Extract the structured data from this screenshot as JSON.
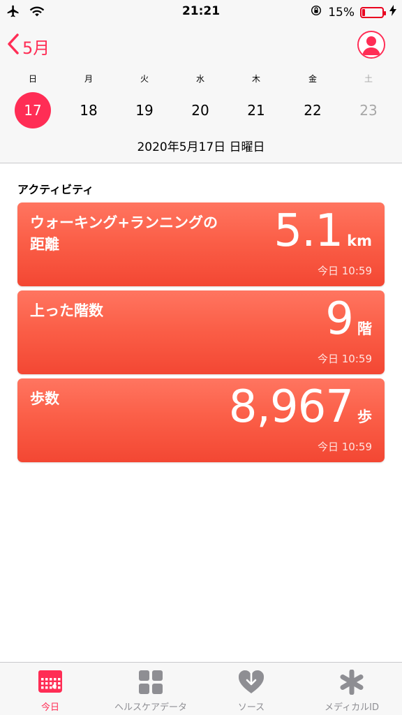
{
  "status_bar": {
    "time": "21:21",
    "battery_percent": "15%",
    "battery_level": 0.15
  },
  "header": {
    "back_label": "5月",
    "week_labels": [
      "日",
      "月",
      "火",
      "水",
      "木",
      "金",
      "土"
    ],
    "week_days": [
      "17",
      "18",
      "19",
      "20",
      "21",
      "22",
      "23"
    ],
    "selected_index": 0,
    "date": "2020年5月17日 日曜日"
  },
  "section": {
    "title": "アクティビティ"
  },
  "cards": [
    {
      "label_line1": "ウォーキング+ランニングの",
      "label_line2": "距離",
      "value": "5.1",
      "unit": "km",
      "time": "今日 10:59"
    },
    {
      "label_line1": "上った階数",
      "label_line2": "",
      "value": "9",
      "unit": "階",
      "time": "今日 10:59"
    },
    {
      "label_line1": "歩数",
      "label_line2": "",
      "value": "8,967",
      "unit": "歩",
      "time": "今日 10:59"
    }
  ],
  "tabs": [
    {
      "label": "今日",
      "icon": "calendar-icon",
      "active": true
    },
    {
      "label": "ヘルスケアデータ",
      "icon": "grid-icon",
      "active": false
    },
    {
      "label": "ソース",
      "icon": "heart-download-icon",
      "active": false
    },
    {
      "label": "メディカルID",
      "icon": "asterisk-icon",
      "active": false
    }
  ],
  "colors": {
    "accent": "#ff2d55",
    "card_gradient_top": "#ff7560",
    "card_gradient_bottom": "#f34733"
  }
}
